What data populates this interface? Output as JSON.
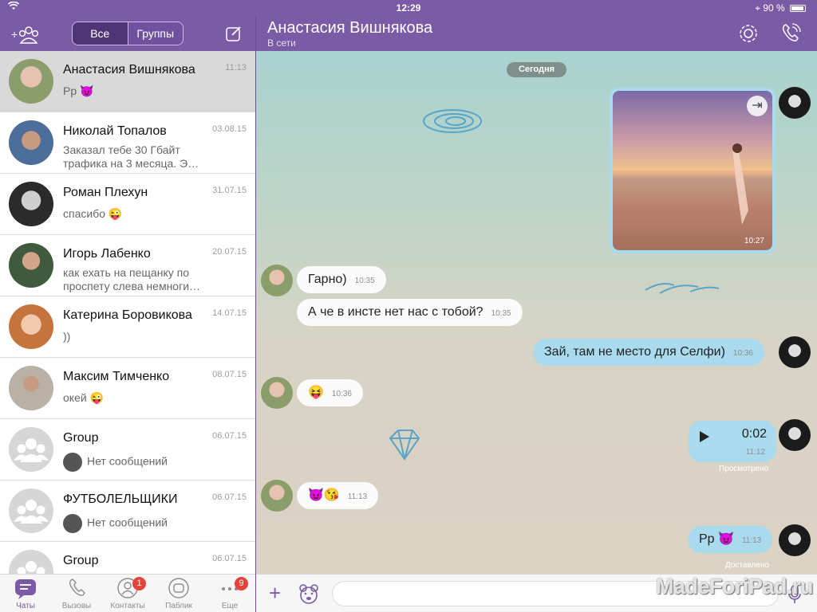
{
  "status_bar": {
    "time": "12:29",
    "battery": "90 %"
  },
  "sidebar": {
    "segment_all": "Все",
    "segment_groups": "Группы",
    "chats": [
      {
        "name": "Анастасия Вишнякова",
        "date": "11:13",
        "message": "Pp 😈",
        "selected": true
      },
      {
        "name": "Николай Топалов",
        "date": "03.08.15",
        "message": "Заказал тебе 30 Гбайт трафика на 3 месяца. Э…"
      },
      {
        "name": "Роман Плехун",
        "date": "31.07.15",
        "message": "спасибо 😜"
      },
      {
        "name": "Игорь Лабенко",
        "date": "20.07.15",
        "message": "как ехать на пещанку по проспету слева немноги…"
      },
      {
        "name": "Катерина Боровикова",
        "date": "14.07.15",
        "message": "))"
      },
      {
        "name": "Максим Тимченко",
        "date": "08.07.15",
        "message": "окей 😜"
      },
      {
        "name": "Group",
        "date": "06.07.15",
        "message": "Нет сообщений",
        "group": true
      },
      {
        "name": "ФУТБОЛЕЛЬЩИКИ",
        "date": "06.07.15",
        "message": "Нет сообщений",
        "group": true
      },
      {
        "name": "Group",
        "date": "06.07.15",
        "message": "",
        "group": true
      }
    ]
  },
  "tabs": [
    {
      "label": "Чаты",
      "icon": "chat-bubble-icon",
      "active": true
    },
    {
      "label": "Вызовы",
      "icon": "phone-icon"
    },
    {
      "label": "Контакты",
      "icon": "contacts-icon",
      "badge": "1"
    },
    {
      "label": "Паблик",
      "icon": "public-chats-icon"
    },
    {
      "label": "Еще",
      "icon": "more-icon",
      "badge": "9"
    }
  ],
  "conversation": {
    "contact_name": "Анастасия Вишнякова",
    "contact_status": "В сети",
    "date_separator": "Сегодня",
    "photo_time": "10:27",
    "messages": [
      {
        "text": "Гарно)",
        "time": "10:35",
        "direction": "in"
      },
      {
        "text": "А че в инсте нет нас с тобой?",
        "time": "10:35",
        "direction": "in"
      },
      {
        "text": "Зай, там не место для Селфи)",
        "time": "10:36",
        "direction": "out"
      },
      {
        "text": "😝",
        "time": "10:36",
        "direction": "in"
      },
      {
        "text": "😈😘",
        "time": "11:13",
        "direction": "in"
      },
      {
        "text": "Pp 😈",
        "time": "11:13",
        "direction": "out"
      }
    ],
    "voice": {
      "duration": "0:02",
      "time": "11:12",
      "state": "Просмотрено"
    },
    "last_state": "Доставлено"
  },
  "input": {
    "placeholder": ""
  },
  "watermark": "MadeForiPad.ru",
  "colors": {
    "accent": "#7b5ba6",
    "bubble_out": "#a9daee",
    "bubble_in": "#fbfbfb",
    "badge": "#e3443a"
  }
}
